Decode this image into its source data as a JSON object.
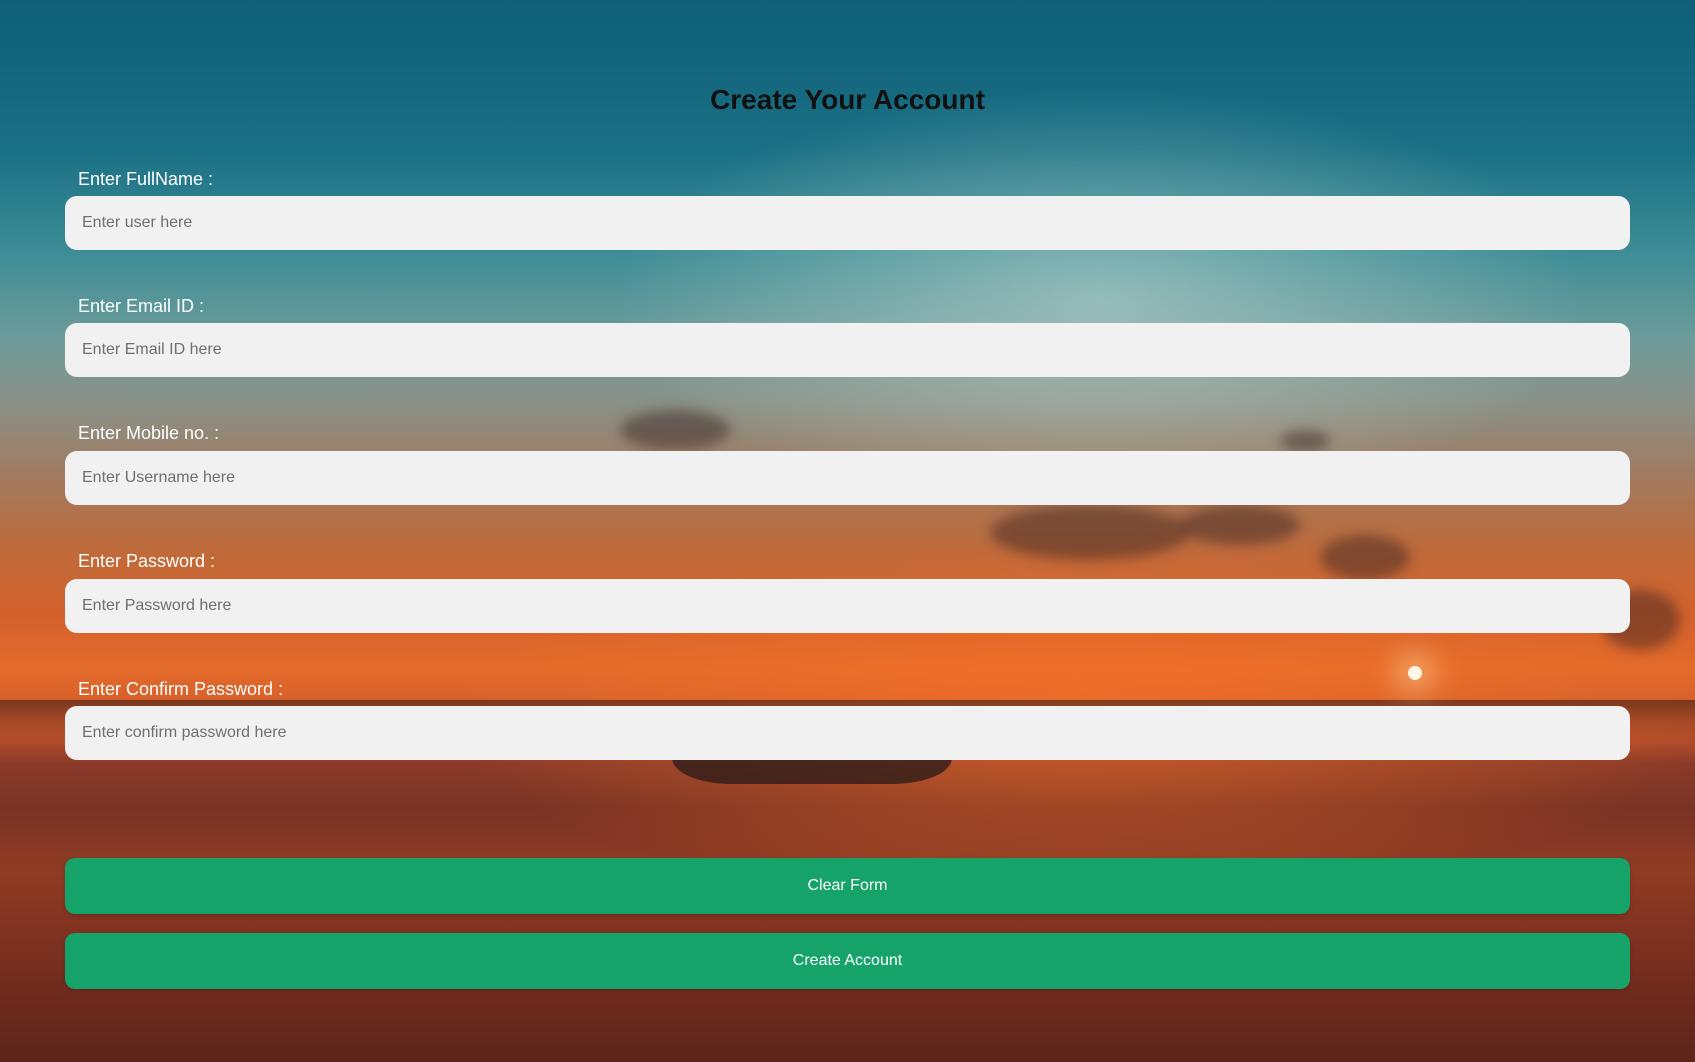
{
  "page": {
    "title": "Create Your Account"
  },
  "form": {
    "fields": [
      {
        "label": "Enter FullName :",
        "placeholder": "Enter user here",
        "value": ""
      },
      {
        "label": "Enter Email ID :",
        "placeholder": "Enter Email ID here",
        "value": ""
      },
      {
        "label": "Enter Mobile no. :",
        "placeholder": "Enter Username here",
        "value": ""
      },
      {
        "label": "Enter Password :",
        "placeholder": "Enter Password here",
        "value": ""
      },
      {
        "label": "Enter Confirm Password :",
        "placeholder": "Enter confirm password here",
        "value": ""
      }
    ],
    "buttons": {
      "clear_label": "Clear Form",
      "create_label": "Create Account"
    }
  },
  "colors": {
    "button_background": "#16a36a",
    "input_background": "#f1f1f1",
    "label_text": "#ffffff",
    "title_text": "#111111"
  }
}
